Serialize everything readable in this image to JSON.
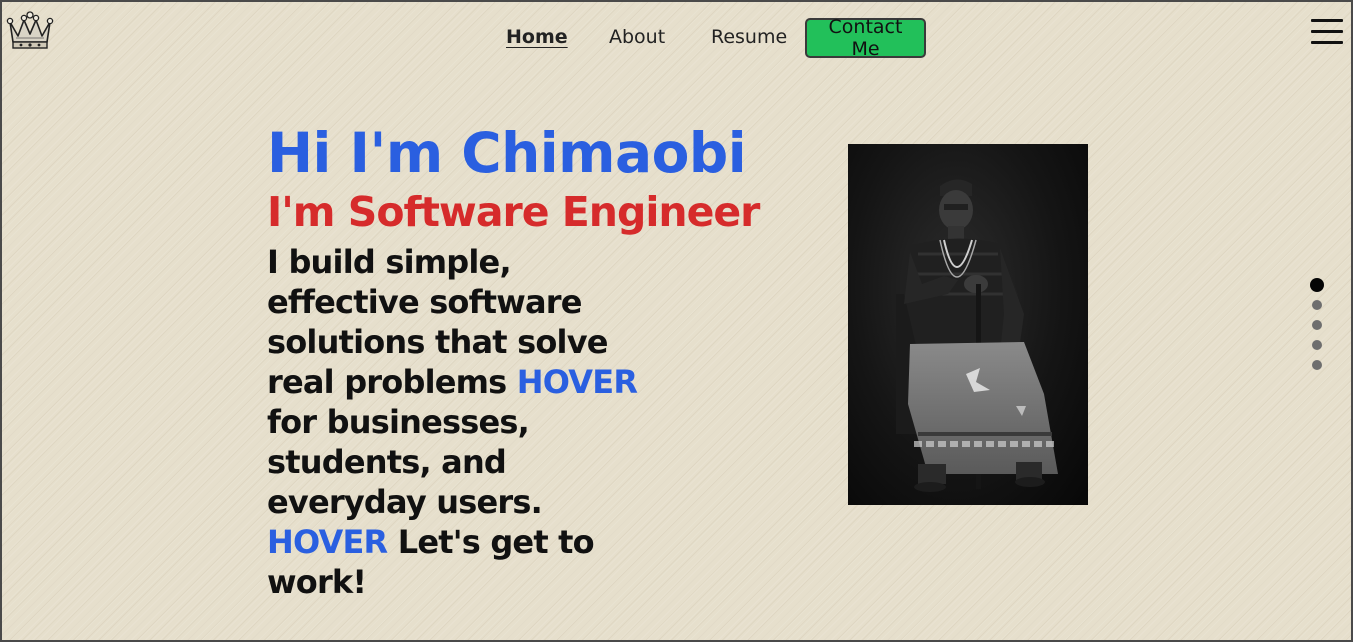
{
  "header": {
    "logo_icon": "crown-icon",
    "menu_icon": "hamburger-menu-icon"
  },
  "nav": {
    "home": "Home",
    "about": "About",
    "resume": "Resume",
    "contact": "Contact Me",
    "contact_color": "#22c05a"
  },
  "hero": {
    "greeting": "Hi I'm Chimaobi",
    "role": "I'm Software Engineer",
    "desc_part1": "I build simple, effective software solutions that solve real problems ",
    "hover1": "HOVER",
    "desc_part2": " for businesses, students, and everyday users. ",
    "hover2": "HOVER",
    "desc_part3": " Let's get to work!",
    "greeting_color": "#2a5fe0",
    "role_color": "#d62b2b"
  },
  "carousel": {
    "dot_count": 5,
    "active_index": 0
  }
}
